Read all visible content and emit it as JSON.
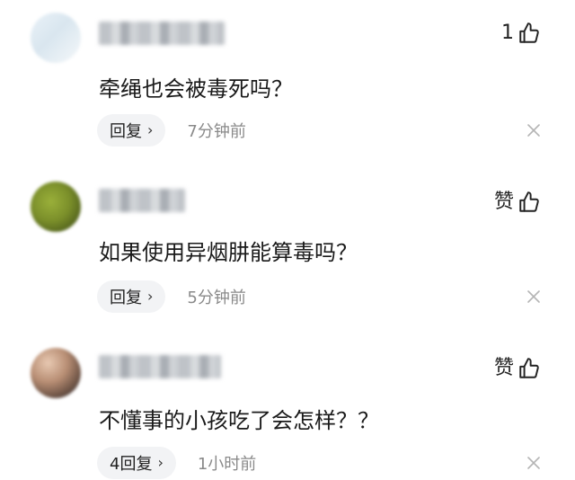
{
  "comments": [
    {
      "like_count": "1",
      "text": "牵绳也会被毒死吗？",
      "reply_label": "回复",
      "time": "7分钟前"
    },
    {
      "like_count": "赞",
      "text": "如果使用异烟肼能算毒吗？",
      "reply_label": "回复",
      "time": "5分钟前"
    },
    {
      "like_count": "赞",
      "text": "不懂事的小孩吃了会怎样？？",
      "reply_label": "4回复",
      "time": "1小时前"
    }
  ],
  "icons": {
    "like": "thumbs-up-icon",
    "chevron": "chevron-right-icon",
    "close": "close-icon"
  }
}
